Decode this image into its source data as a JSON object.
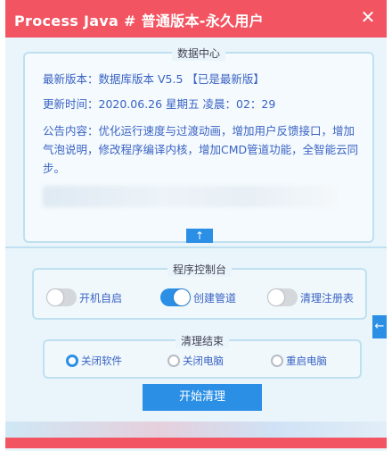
{
  "window": {
    "title": "Process  Java # 普通版本-永久用户",
    "close_label": "✕"
  },
  "data_center": {
    "legend": "数据中心",
    "latest_version": "最新版本：数据库版本 V5.5 【已是最新版】",
    "update_time": "更新时间：2020.06.26  星期五  凌晨：02：29",
    "notice": "公告内容：优化运行速度与过渡动画，增加用户反馈接口，增加气泡说明，修改程序编译内核，增加CMD管道功能，全智能云同步。",
    "scroll_top_label": "↑"
  },
  "control_panel": {
    "legend": "程序控制台",
    "toggles": [
      {
        "label": "开机自启",
        "on": false
      },
      {
        "label": "创建管道",
        "on": true
      },
      {
        "label": "清理注册表",
        "on": false
      }
    ]
  },
  "side_tab": {
    "label": "←"
  },
  "clean_end": {
    "legend": "清理结束",
    "options": [
      {
        "label": "关闭软件",
        "checked": true
      },
      {
        "label": "关闭电脑",
        "checked": false
      },
      {
        "label": "重启电脑",
        "checked": false
      }
    ]
  },
  "start_button": {
    "label": "开始清理"
  },
  "colors": {
    "title_bar": "#f25461",
    "accent": "#2b8fe6",
    "text": "#3a63c4",
    "border": "#bfe0f0"
  }
}
